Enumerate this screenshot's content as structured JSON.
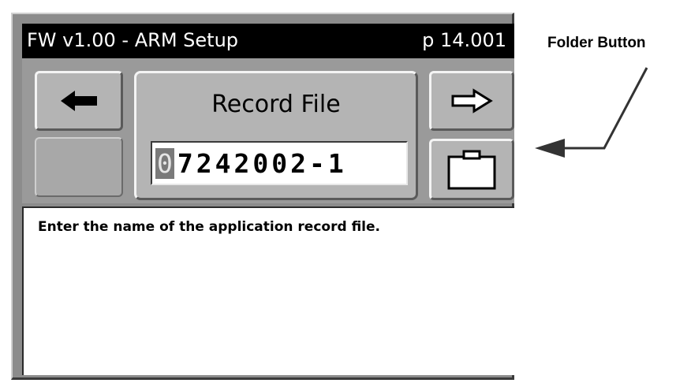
{
  "titlebar": {
    "title": "FW v1.00 - ARM Setup",
    "page": "p 14.001"
  },
  "field": {
    "label": "Record File",
    "value_cursor_char": "0",
    "value_rest": "7242002-1"
  },
  "help": {
    "text": "Enter the name of the application record file."
  },
  "buttons": {
    "back_icon": "left-arrow-icon",
    "next_icon": "right-arrow-icon",
    "folder_icon": "folder-icon"
  },
  "annotation": {
    "label": "Folder Button"
  },
  "colors": {
    "titlebar_bg": "#000000",
    "panel_bg": "#b4b4b4",
    "frame_bg": "#8c8c8c"
  }
}
